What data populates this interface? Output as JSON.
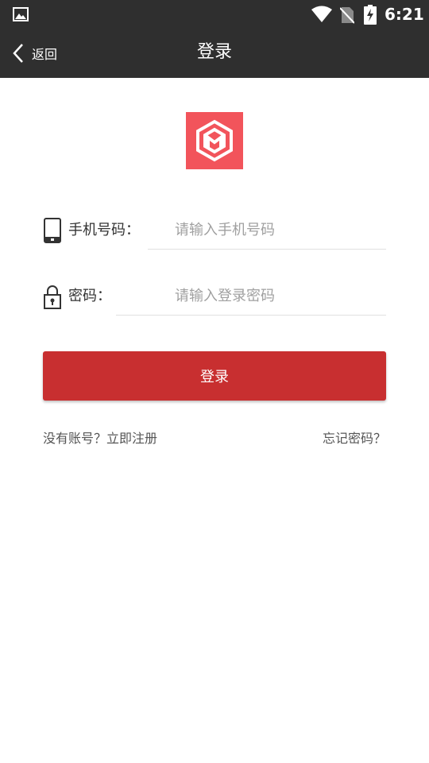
{
  "status_bar": {
    "time": "6:21",
    "icons": [
      "gallery-icon",
      "wifi-icon",
      "no-sim-icon",
      "battery-charging-icon"
    ]
  },
  "app_bar": {
    "back_label": "返回",
    "title": "登录"
  },
  "logo": {
    "icon": "app-logo-icon",
    "color": "#f2545b"
  },
  "form": {
    "phone": {
      "label": "手机号码：",
      "placeholder": "请输入手机号码",
      "value": "",
      "icon": "phone-icon"
    },
    "password": {
      "label": "密码：",
      "placeholder": "请输入登录密码",
      "value": "",
      "icon": "lock-icon"
    }
  },
  "login_button": {
    "label": "登录",
    "color": "#c82f30"
  },
  "links": {
    "register": "没有账号？立即注册",
    "forgot": "忘记密码？"
  },
  "colors": {
    "bar_background": "#2f2f2f"
  }
}
